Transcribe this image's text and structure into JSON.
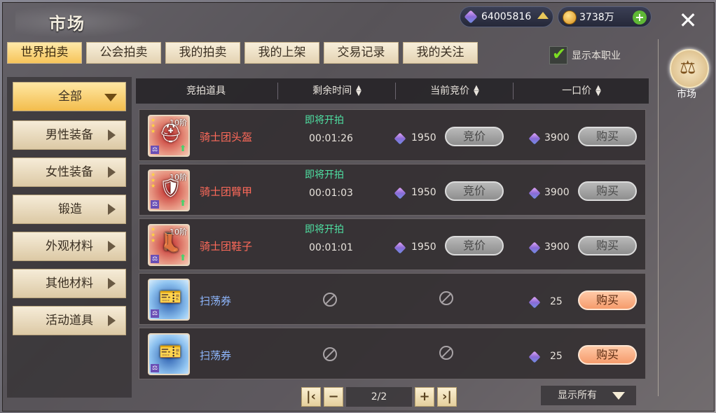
{
  "header": {
    "title": "市场",
    "gem_amount": "64005816",
    "coin_amount": "3738万",
    "market_label": "市场"
  },
  "tabs": [
    {
      "label": "世界拍卖",
      "active": true
    },
    {
      "label": "公会拍卖",
      "active": false
    },
    {
      "label": "我的拍卖",
      "active": false
    },
    {
      "label": "我的上架",
      "active": false
    },
    {
      "label": "交易记录",
      "active": false
    },
    {
      "label": "我的关注",
      "active": false
    }
  ],
  "filter_checkbox": {
    "label": "显示本职业",
    "checked": true
  },
  "categories": [
    {
      "label": "全部",
      "active": true
    },
    {
      "label": "男性装备",
      "active": false
    },
    {
      "label": "女性装备",
      "active": false
    },
    {
      "label": "锻造",
      "active": false
    },
    {
      "label": "外观材料",
      "active": false
    },
    {
      "label": "其他材料",
      "active": false
    },
    {
      "label": "活动道具",
      "active": false
    }
  ],
  "columns": {
    "item": "竞拍道具",
    "time": "剩余时间",
    "bid": "当前竞价",
    "buyout": "一口价"
  },
  "rows": [
    {
      "name": "骑士团头盔",
      "status": "即将开拍",
      "time": "00:01:26",
      "bid": "1950",
      "bid_button": "竞价",
      "buyout": "3900",
      "buy_button": "购买",
      "level_badge": "10阶",
      "icon": "helmet-icon",
      "rarity": "red",
      "buy_enabled": false
    },
    {
      "name": "骑士团臂甲",
      "status": "即将开拍",
      "time": "00:01:03",
      "bid": "1950",
      "bid_button": "竞价",
      "buyout": "3900",
      "buy_button": "购买",
      "level_badge": "10阶",
      "icon": "bracer-icon",
      "rarity": "red",
      "buy_enabled": false
    },
    {
      "name": "骑士团鞋子",
      "status": "即将开拍",
      "time": "00:01:01",
      "bid": "1950",
      "bid_button": "竞价",
      "buyout": "3900",
      "buy_button": "购买",
      "level_badge": "10阶",
      "icon": "boots-icon",
      "rarity": "red",
      "buy_enabled": false
    },
    {
      "name": "扫荡券",
      "buyout": "25",
      "buy_button": "购买",
      "icon": "sweep-ticket-icon",
      "rarity": "blue",
      "buy_enabled": true
    },
    {
      "name": "扫荡券",
      "buyout": "25",
      "buy_button": "购买",
      "icon": "sweep-ticket-icon",
      "rarity": "blue",
      "buy_enabled": true
    }
  ],
  "pagination": {
    "display": "2/2"
  },
  "display_filter": {
    "label": "显示所有"
  }
}
